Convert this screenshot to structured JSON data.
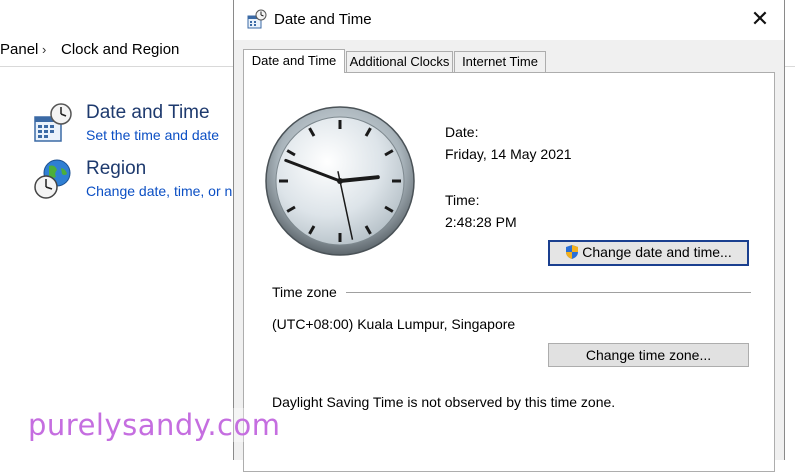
{
  "breadcrumb": {
    "items": [
      "Panel",
      "Clock and Region"
    ],
    "separator": "›"
  },
  "control_panel": {
    "items": [
      {
        "title": "Date and Time",
        "links": [
          "Set the time and date"
        ],
        "icon": "calendar-clock-icon"
      },
      {
        "title": "Region",
        "links": [
          "Change date, time, or n"
        ],
        "icon": "globe-clock-icon"
      }
    ]
  },
  "dialog": {
    "title": "Date and Time",
    "close_label": "✕",
    "tabs": [
      "Date and Time",
      "Additional Clocks",
      "Internet Time"
    ],
    "active_tab": "Date and Time",
    "date_label": "Date:",
    "date_value": "Friday, 14 May 2021",
    "time_label": "Time:",
    "time_value": "2:48:28 PM",
    "change_datetime_button": "Change date and time...",
    "timezone_heading": "Time zone",
    "timezone_value": "(UTC+08:00) Kuala Lumpur, Singapore",
    "change_timezone_button": "Change time zone...",
    "dst_note": "Daylight Saving Time is not observed by this time zone.",
    "clock": {
      "hour": 2,
      "minute": 48,
      "second": 28
    }
  },
  "watermark": "purelysandy.com",
  "colors": {
    "link": "#0b4fc4",
    "title": "#1e3a6e",
    "default_button_border": "#1a3f8f",
    "watermark": "#c56ee0",
    "shield_blue": "#2a6fd6",
    "shield_gold": "#f2b01e"
  }
}
